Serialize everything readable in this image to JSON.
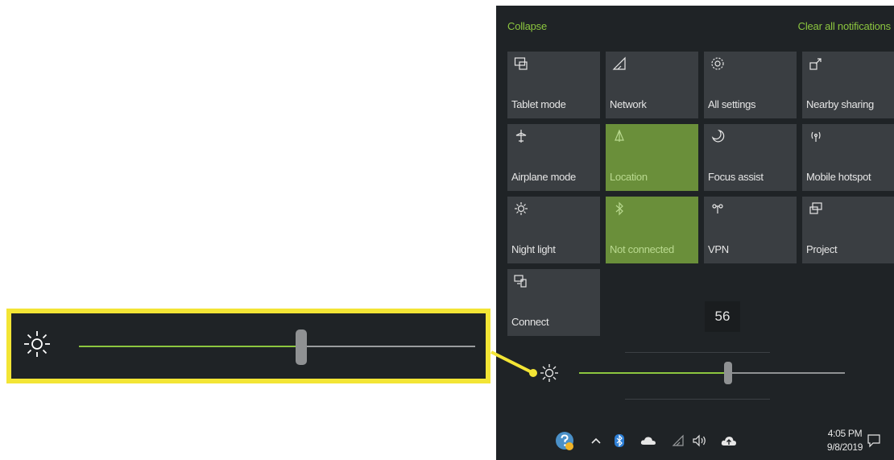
{
  "action_center": {
    "collapse_label": "Collapse",
    "clear_label": "Clear all notifications",
    "tiles": [
      {
        "label": "Tablet mode",
        "icon": "tablet-mode-icon",
        "active": false
      },
      {
        "label": "Network",
        "icon": "network-icon",
        "active": false
      },
      {
        "label": "All settings",
        "icon": "gear-icon",
        "active": false
      },
      {
        "label": "Nearby sharing",
        "icon": "nearby-sharing-icon",
        "active": false
      },
      {
        "label": "Airplane mode",
        "icon": "airplane-icon",
        "active": false
      },
      {
        "label": "Location",
        "icon": "location-icon",
        "active": true
      },
      {
        "label": "Focus assist",
        "icon": "moon-icon",
        "active": false
      },
      {
        "label": "Mobile hotspot",
        "icon": "hotspot-icon",
        "active": false
      },
      {
        "label": "Night light",
        "icon": "night-light-icon",
        "active": false
      },
      {
        "label": "Not connected",
        "icon": "bluetooth-icon",
        "active": true
      },
      {
        "label": "VPN",
        "icon": "vpn-icon",
        "active": false
      },
      {
        "label": "Project",
        "icon": "project-icon",
        "active": false
      },
      {
        "label": "Connect",
        "icon": "connect-icon",
        "active": false
      }
    ],
    "brightness": {
      "value_label": "56",
      "value_fraction": 0.56,
      "icon": "brightness-icon"
    }
  },
  "taskbar": {
    "icons": [
      "help-icon",
      "chevron-up-icon",
      "bluetooth-icon",
      "onedrive-icon",
      "network-icon",
      "volume-icon",
      "cloud-upload-icon",
      "notification-icon"
    ],
    "time": "4:05 PM",
    "date": "9/8/2019"
  },
  "callout": {
    "brightness_value_fraction": 0.56,
    "border_color": "#f3e535",
    "accent_color": "#8cc63f"
  },
  "colors": {
    "panel_bg": "#1f2326",
    "tile_bg": "#3a3e42",
    "tile_active_bg": "#6a8f3a",
    "accent": "#8cc63f"
  }
}
